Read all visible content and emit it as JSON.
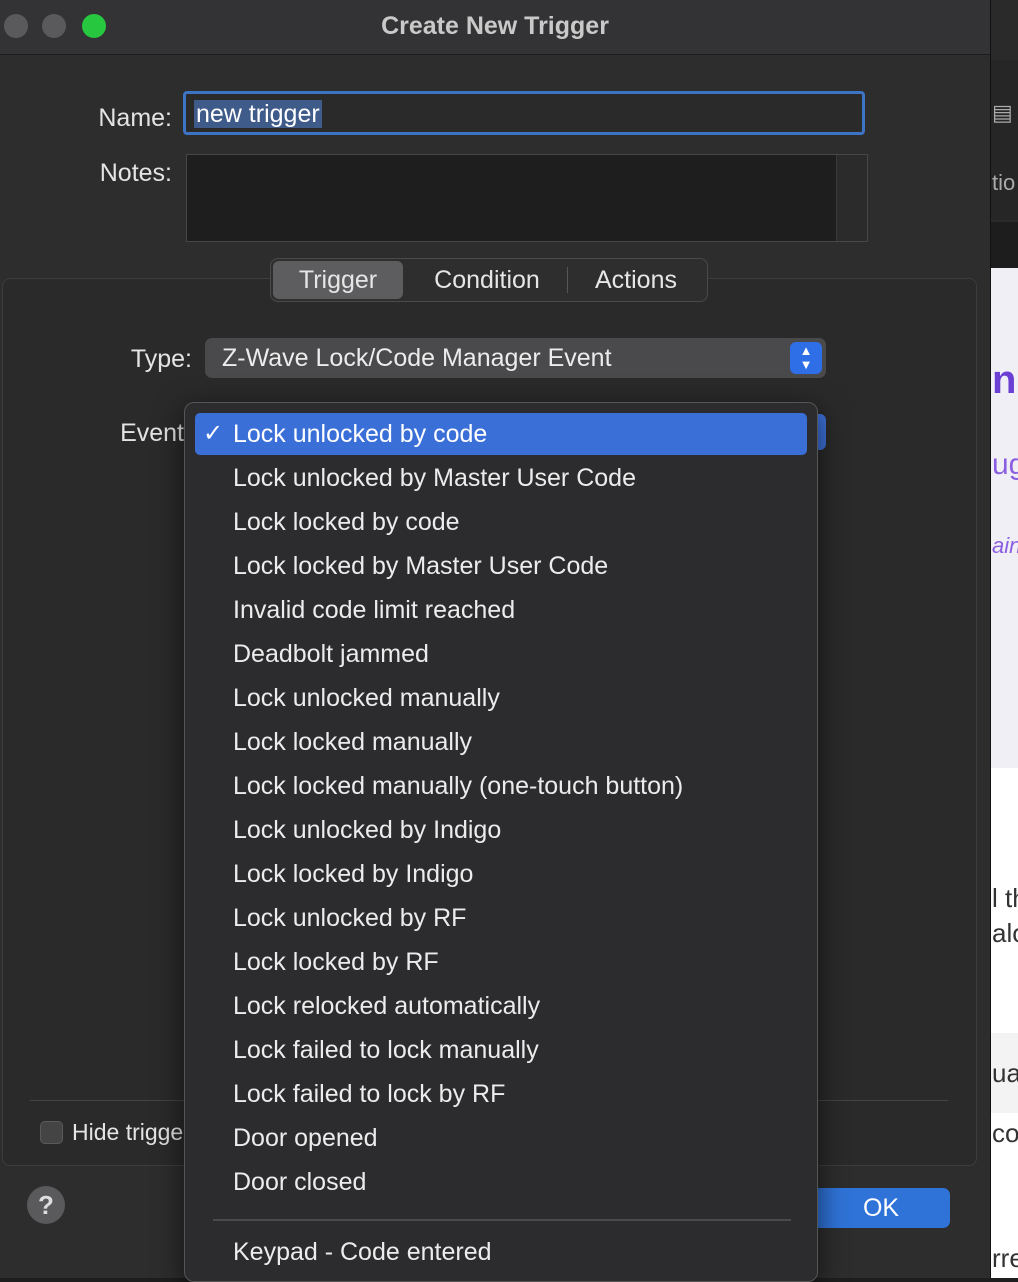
{
  "window": {
    "title": "Create New Trigger",
    "traffic_colors": [
      "#5a5a5c",
      "#5a5a5c",
      "#27c840"
    ]
  },
  "form": {
    "name_label": "Name:",
    "name_value": "new trigger",
    "notes_label": "Notes:",
    "type_label": "Type:",
    "type_value": "Z-Wave Lock/Code Manager Event",
    "event_label": "Event"
  },
  "tabs": [
    {
      "label": "Trigger",
      "active": true
    },
    {
      "label": "Condition",
      "active": false
    },
    {
      "label": "Actions",
      "active": false
    }
  ],
  "footer": {
    "hide_label": "Hide trigger",
    "help_label": "?",
    "ok_label": "OK"
  },
  "event_menu": {
    "check_glyph": "✓",
    "items": [
      {
        "label": "Lock unlocked by code",
        "selected": true
      },
      {
        "label": "Lock unlocked by Master User Code"
      },
      {
        "label": "Lock locked by code"
      },
      {
        "label": "Lock locked by Master User Code"
      },
      {
        "label": "Invalid code limit reached"
      },
      {
        "label": "Deadbolt jammed"
      },
      {
        "label": "Lock unlocked manually"
      },
      {
        "label": "Lock locked manually"
      },
      {
        "label": "Lock locked manually (one-touch button)"
      },
      {
        "label": "Lock unlocked by Indigo"
      },
      {
        "label": "Lock locked by Indigo"
      },
      {
        "label": "Lock unlocked by RF"
      },
      {
        "label": "Lock locked by RF"
      },
      {
        "label": "Lock relocked automatically"
      },
      {
        "label": "Lock failed to lock manually"
      },
      {
        "label": "Lock failed to lock by RF"
      },
      {
        "label": "Door opened"
      },
      {
        "label": "Door closed"
      }
    ],
    "after_separator": [
      {
        "label": "Keypad - Code entered"
      }
    ]
  },
  "background_app": {
    "fragments": [
      "tio",
      "n",
      "ug",
      "ain",
      "l th",
      "alo",
      "ua",
      "co",
      "rresponding loc"
    ]
  }
}
